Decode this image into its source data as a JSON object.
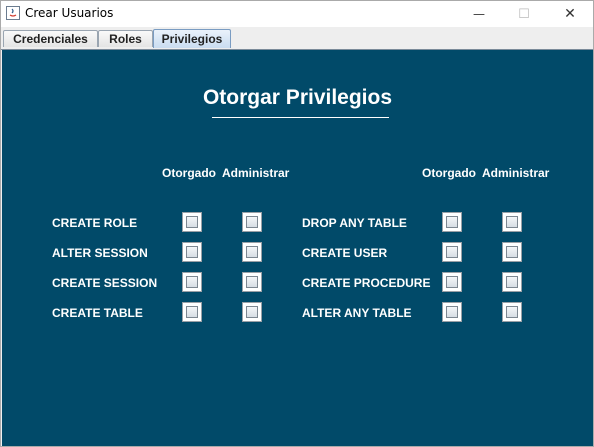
{
  "window": {
    "title": "Crear Usuarios"
  },
  "titlebar": {
    "minimize": "—",
    "maximize": "☐",
    "close": "✕"
  },
  "tabs": [
    {
      "label": "Credenciales",
      "active": false
    },
    {
      "label": "Roles",
      "active": false
    },
    {
      "label": "Privilegios",
      "active": true
    }
  ],
  "panel": {
    "title": "Otorgar Privilegios",
    "col_otorgado": "Otorgado",
    "col_administrar": "Administrar",
    "left": [
      {
        "label": "CREATE ROLE",
        "otorgado": false,
        "administrar": false
      },
      {
        "label": "ALTER SESSION",
        "otorgado": false,
        "administrar": false
      },
      {
        "label": "CREATE SESSION",
        "otorgado": false,
        "administrar": false
      },
      {
        "label": "CREATE TABLE",
        "otorgado": false,
        "administrar": false
      }
    ],
    "right": [
      {
        "label": "DROP ANY TABLE",
        "otorgado": false,
        "administrar": false
      },
      {
        "label": "CREATE USER",
        "otorgado": false,
        "administrar": false
      },
      {
        "label": "CREATE PROCEDURE",
        "otorgado": false,
        "administrar": false
      },
      {
        "label": "ALTER ANY TABLE",
        "otorgado": false,
        "administrar": false
      }
    ]
  },
  "colors": {
    "panel_bg": "#014a69",
    "text": "#ffffff"
  }
}
